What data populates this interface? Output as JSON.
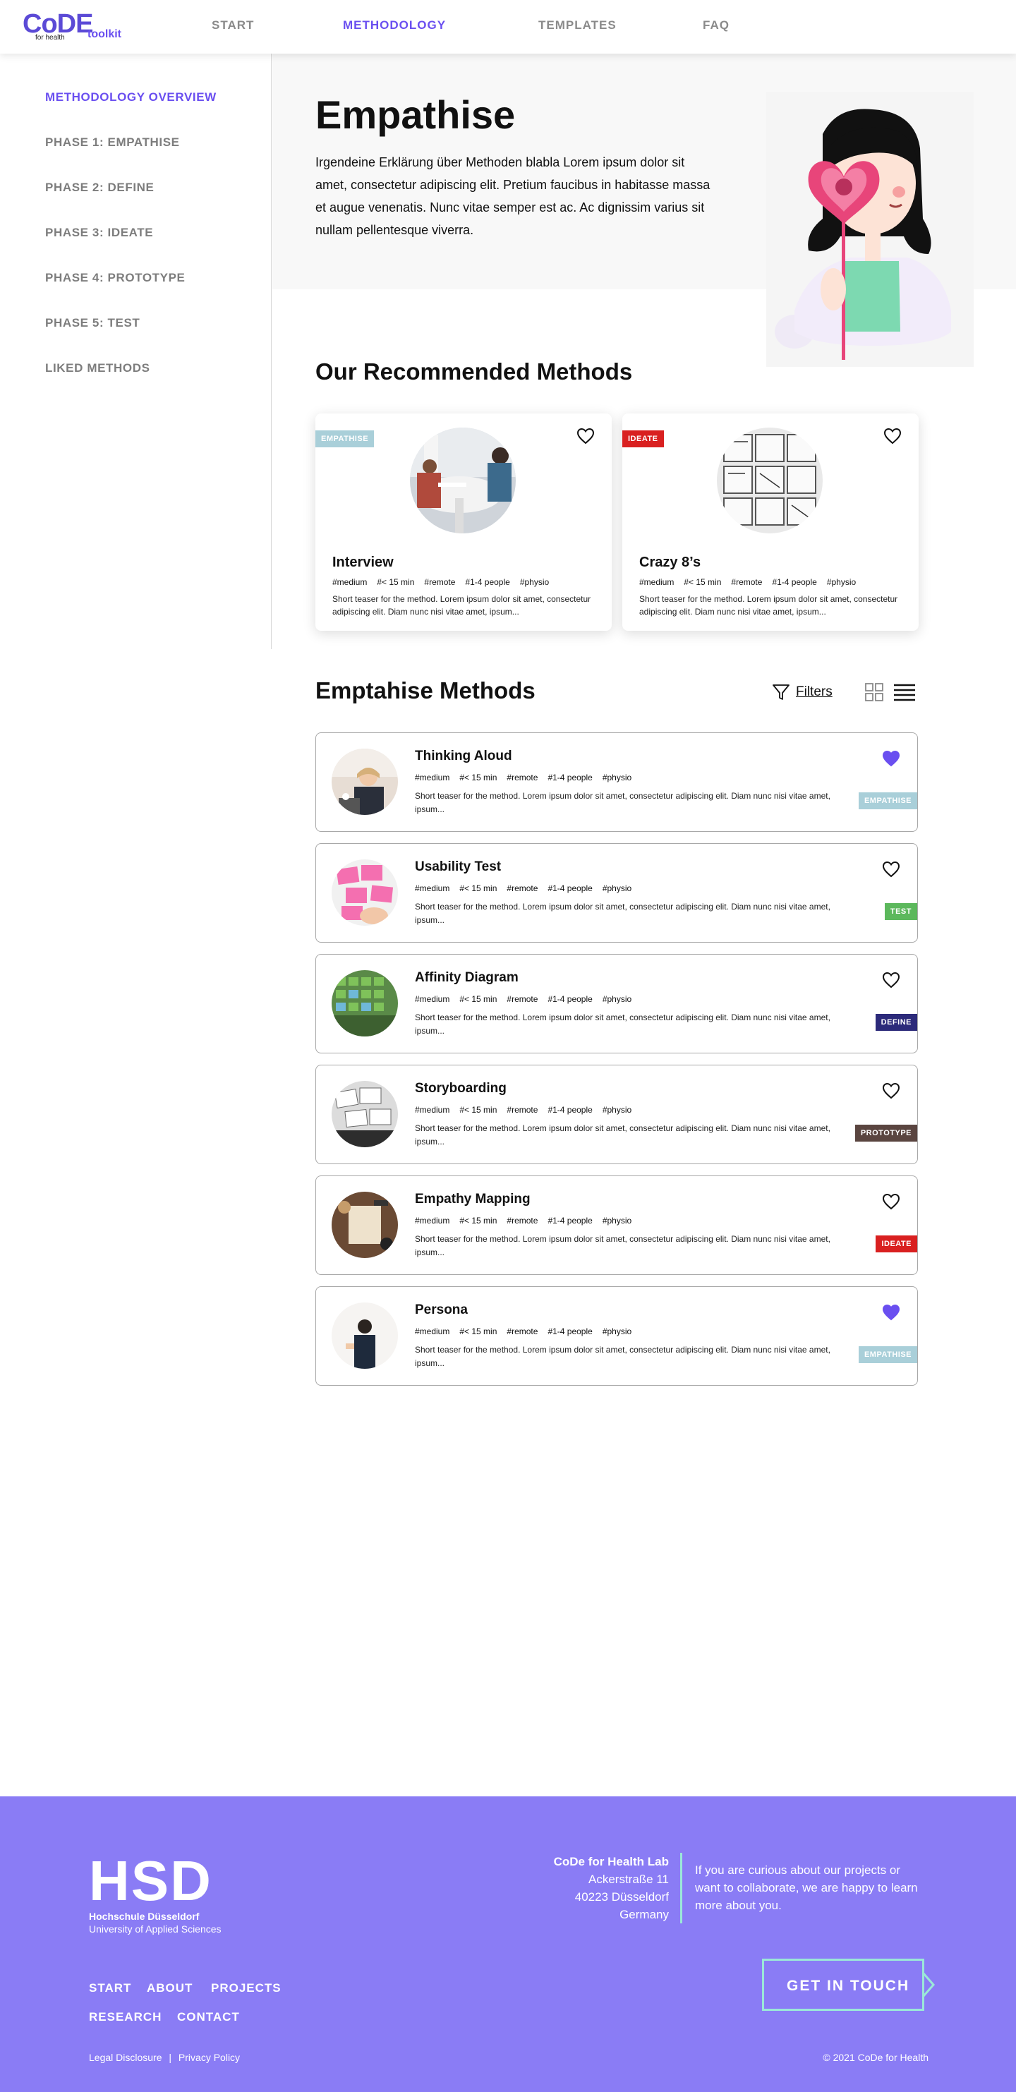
{
  "header": {
    "logo_text": "CoDE",
    "logo_sub": "for health",
    "logo_toolkit": "toolkit",
    "nav": [
      "START",
      "METHODOLOGY",
      "TEMPLATES",
      "FAQ"
    ],
    "active_nav": "METHODOLOGY"
  },
  "sidebar": {
    "items": [
      "METHODOLOGY OVERVIEW",
      "PHASE 1: EMPATHISE",
      "PHASE 2: DEFINE",
      "PHASE 3: IDEATE",
      "PHASE 4: PROTOTYPE",
      "PHASE 5: TEST",
      "LIKED METHODS"
    ],
    "active_item": "METHODOLOGY OVERVIEW"
  },
  "hero": {
    "title": "Empathise",
    "text": "Irgendeine Erklärung über Methoden blabla Lorem ipsum dolor sit amet, consectetur adipiscing elit. Pretium faucibus in habitasse massa et augue venenatis. Nunc vitae semper est ac. Ac dignissim varius sit nullam pellentesque viverra."
  },
  "recommended": {
    "title": "Our Recommended Methods",
    "cards": [
      {
        "name": "Interview",
        "badge": "EMPATHISE",
        "badge_color": "#a9cfd9",
        "tags": [
          "#medium",
          "#< 15 min",
          "#remote",
          "#1-4 people",
          "#physio"
        ],
        "teaser": "Short teaser for the method. Lorem ipsum dolor sit amet, consectetur adipiscing elit. Diam nunc nisi vitae amet, ipsum...",
        "liked": false
      },
      {
        "name": "Crazy 8’s",
        "badge": "IDEATE",
        "badge_color": "#d92020",
        "tags": [
          "#medium",
          "#< 15 min",
          "#remote",
          "#1-4 people",
          "#physio"
        ],
        "teaser": "Short teaser for the method. Lorem ipsum dolor sit amet, consectetur adipiscing elit. Diam nunc nisi vitae amet, ipsum...",
        "liked": false
      }
    ]
  },
  "methods": {
    "title": "Emptahise Methods",
    "filters_label": "Filters",
    "items": [
      {
        "name": "Thinking Aloud",
        "badge": "EMPATHISE",
        "badge_color": "#a9cfd9",
        "liked": true,
        "tags": [
          "#medium",
          "#< 15 min",
          "#remote",
          "#1-4 people",
          "#physio"
        ],
        "teaser": "Short teaser for the method. Lorem ipsum dolor sit amet, consectetur adipiscing elit. Diam nunc nisi vitae amet, ipsum..."
      },
      {
        "name": "Usability Test",
        "badge": "TEST",
        "badge_color": "#5cb85c",
        "liked": false,
        "tags": [
          "#medium",
          "#< 15 min",
          "#remote",
          "#1-4 people",
          "#physio"
        ],
        "teaser": "Short teaser for the method. Lorem ipsum dolor sit amet, consectetur adipiscing elit. Diam nunc nisi vitae amet, ipsum..."
      },
      {
        "name": "Affinity Diagram",
        "badge": "DEFINE",
        "badge_color": "#2c2a7a",
        "liked": false,
        "tags": [
          "#medium",
          "#< 15 min",
          "#remote",
          "#1-4 people",
          "#physio"
        ],
        "teaser": "Short teaser for the method. Lorem ipsum dolor sit amet, consectetur adipiscing elit. Diam nunc nisi vitae amet, ipsum..."
      },
      {
        "name": "Storyboarding",
        "badge": "PROTOTYPE",
        "badge_color": "#5a4540",
        "liked": false,
        "tags": [
          "#medium",
          "#< 15 min",
          "#remote",
          "#1-4 people",
          "#physio"
        ],
        "teaser": "Short teaser for the method. Lorem ipsum dolor sit amet, consectetur adipiscing elit. Diam nunc nisi vitae amet, ipsum..."
      },
      {
        "name": "Empathy Mapping",
        "badge": "IDEATE",
        "badge_color": "#d92020",
        "liked": false,
        "tags": [
          "#medium",
          "#< 15 min",
          "#remote",
          "#1-4 people",
          "#physio"
        ],
        "teaser": "Short teaser for the method. Lorem ipsum dolor sit amet, consectetur adipiscing elit. Diam nunc nisi vitae amet, ipsum..."
      },
      {
        "name": "Persona",
        "badge": "EMPATHISE",
        "badge_color": "#a9cfd9",
        "liked": true,
        "tags": [
          "#medium",
          "#< 15 min",
          "#remote",
          "#1-4 people",
          "#physio"
        ],
        "teaser": "Short teaser for the method. Lorem ipsum dolor sit amet, consectetur adipiscing elit. Diam nunc nisi vitae amet, ipsum..."
      }
    ]
  },
  "footer": {
    "logo": "HSD",
    "school_name": "Hochschule Düsseldorf",
    "school_sub": "University of Applied Sciences",
    "links_row1": [
      "START",
      "ABOUT",
      "PROJECTS"
    ],
    "links_row2": [
      "RESEARCH",
      "CONTACT"
    ],
    "lab_name": "CoDe for Health Lab",
    "street": "Ackerstraße 11",
    "city": "40223 Düsseldorf",
    "country": "Germany",
    "contact_text": "If you are curious about our projects or want to collaborate, we are happy to learn more about you.",
    "cta": "GET IN TOUCH",
    "legal_1": "Legal Disclosure",
    "legal_sep": "|",
    "legal_2": "Privacy Policy",
    "copyright": "© 2021 CoDe for Health"
  },
  "colors": {
    "accent": "#6a4ff0",
    "footer_bg": "#8a7cf5",
    "cta_border": "#9be8d8",
    "liked_heart": "#6a4ff0"
  }
}
